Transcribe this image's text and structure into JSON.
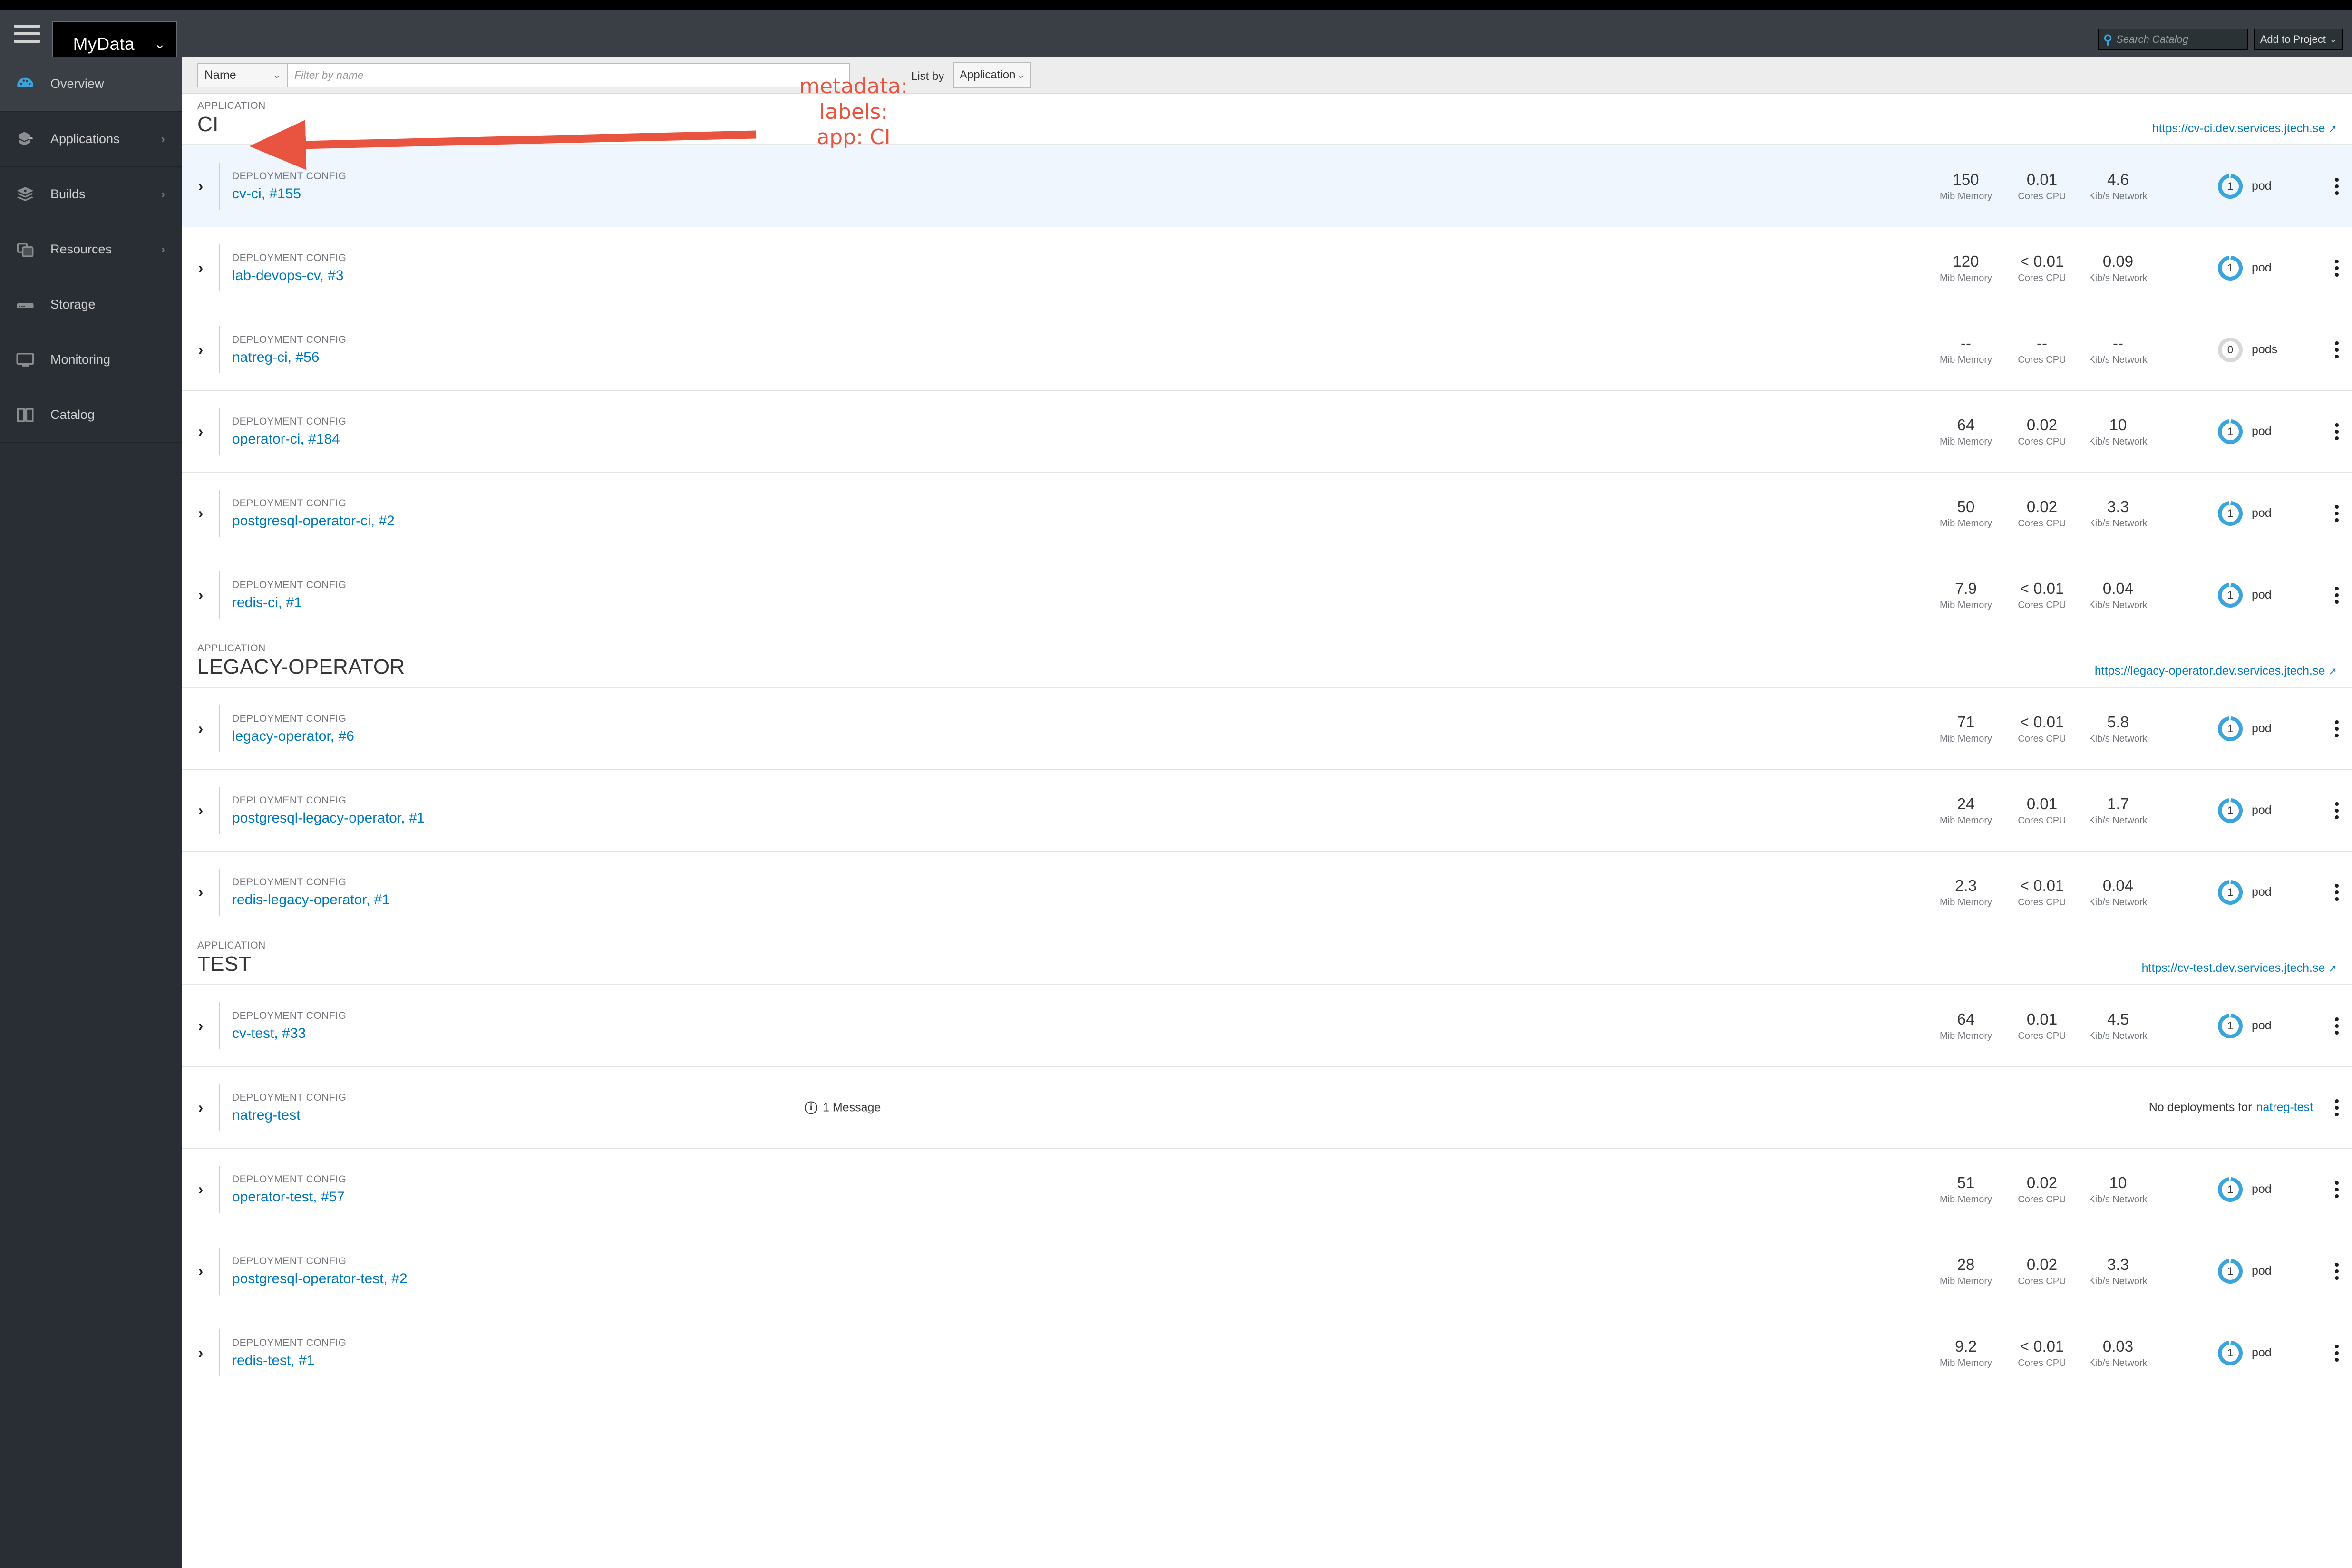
{
  "masthead": {
    "hamburger_icon": "hamburger-menu-icon",
    "project_name": "MyData",
    "project_caret": "⌄",
    "search": {
      "icon": "search-icon",
      "placeholder": "Search Catalog",
      "value": ""
    },
    "add_to_project": {
      "label": "Add to Project",
      "caret": "⌄"
    }
  },
  "sidebar": {
    "items": [
      {
        "label": "Overview",
        "icon": "dashboard-icon",
        "active": true,
        "expandable": false
      },
      {
        "label": "Applications",
        "icon": "applications-icon",
        "active": false,
        "expandable": true
      },
      {
        "label": "Builds",
        "icon": "builds-icon",
        "active": false,
        "expandable": true
      },
      {
        "label": "Resources",
        "icon": "resources-icon",
        "active": false,
        "expandable": true
      },
      {
        "label": "Storage",
        "icon": "storage-icon",
        "active": false,
        "expandable": false
      },
      {
        "label": "Monitoring",
        "icon": "monitoring-icon",
        "active": false,
        "expandable": false
      },
      {
        "label": "Catalog",
        "icon": "catalog-icon",
        "active": false,
        "expandable": false
      }
    ],
    "caret_glyph": "›"
  },
  "toolbar": {
    "filter_type": "Name",
    "filter_caret": "⌄",
    "filter_placeholder": "Filter by name",
    "filter_value": "",
    "list_by_label": "List by",
    "list_by_value": "Application",
    "list_by_caret": "⌄"
  },
  "annotation": {
    "line1": "metadata:",
    "line2": "labels:",
    "line3": "app: CI",
    "color": "#e8543f",
    "arrow": "arrow pointing from annotation to CI application title"
  },
  "labels": {
    "application_kicker": "APPLICATION",
    "deployment_kicker": "DEPLOYMENT CONFIG",
    "memory_label": "Mib Memory",
    "cpu_label": "Cores CPU",
    "network_label": "Kib/s Network",
    "pod_singular": "pod",
    "pod_plural": "pods",
    "external_link_icon": "external-link-icon",
    "expand_icon": "chevron-right-icon",
    "kebab_icon": "kebab-menu-icon",
    "info_icon": "info-circle-icon"
  },
  "colors": {
    "link": "#0079bc",
    "accent_donut": "#39a5dc",
    "highlight_row": "#eff6fd",
    "masthead": "#393f44",
    "sidebar": "#292e34",
    "annotation_red": "#e8543f"
  },
  "applications": [
    {
      "kicker": "APPLICATION",
      "name": "CI",
      "url": "https://cv-ci.dev.services.jtech.se",
      "rows": [
        {
          "kicker": "DEPLOYMENT CONFIG",
          "name": "cv-ci",
          "build": ", #155",
          "memory": "150",
          "cpu": "0.01",
          "network": "4.6",
          "pods": "1",
          "pods_label": "pod",
          "highlight": true
        },
        {
          "kicker": "DEPLOYMENT CONFIG",
          "name": "lab-devops-cv",
          "build": ", #3",
          "memory": "120",
          "cpu": "< 0.01",
          "network": "0.09",
          "pods": "1",
          "pods_label": "pod",
          "highlight": false
        },
        {
          "kicker": "DEPLOYMENT CONFIG",
          "name": "natreg-ci",
          "build": ", #56",
          "memory": "--",
          "cpu": "--",
          "network": "--",
          "pods": "0",
          "pods_label": "pods",
          "highlight": false
        },
        {
          "kicker": "DEPLOYMENT CONFIG",
          "name": "operator-ci",
          "build": ", #184",
          "memory": "64",
          "cpu": "0.02",
          "network": "10",
          "pods": "1",
          "pods_label": "pod",
          "highlight": false
        },
        {
          "kicker": "DEPLOYMENT CONFIG",
          "name": "postgresql-operator-ci",
          "build": ", #2",
          "memory": "50",
          "cpu": "0.02",
          "network": "3.3",
          "pods": "1",
          "pods_label": "pod",
          "highlight": false
        },
        {
          "kicker": "DEPLOYMENT CONFIG",
          "name": "redis-ci",
          "build": ", #1",
          "memory": "7.9",
          "cpu": "< 0.01",
          "network": "0.04",
          "pods": "1",
          "pods_label": "pod",
          "highlight": false
        }
      ]
    },
    {
      "kicker": "APPLICATION",
      "name": "LEGACY-OPERATOR",
      "url": "https://legacy-operator.dev.services.jtech.se",
      "rows": [
        {
          "kicker": "DEPLOYMENT CONFIG",
          "name": "legacy-operator",
          "build": ", #6",
          "memory": "71",
          "cpu": "< 0.01",
          "network": "5.8",
          "pods": "1",
          "pods_label": "pod",
          "highlight": false
        },
        {
          "kicker": "DEPLOYMENT CONFIG",
          "name": "postgresql-legacy-operator",
          "build": ", #1",
          "memory": "24",
          "cpu": "0.01",
          "network": "1.7",
          "pods": "1",
          "pods_label": "pod",
          "highlight": false
        },
        {
          "kicker": "DEPLOYMENT CONFIG",
          "name": "redis-legacy-operator",
          "build": ", #1",
          "memory": "2.3",
          "cpu": "< 0.01",
          "network": "0.04",
          "pods": "1",
          "pods_label": "pod",
          "highlight": false
        }
      ]
    },
    {
      "kicker": "APPLICATION",
      "name": "TEST",
      "url": "https://cv-test.dev.services.jtech.se",
      "rows": [
        {
          "kicker": "DEPLOYMENT CONFIG",
          "name": "cv-test",
          "build": ", #33",
          "memory": "64",
          "cpu": "0.01",
          "network": "4.5",
          "pods": "1",
          "pods_label": "pod",
          "highlight": false
        },
        {
          "kicker": "DEPLOYMENT CONFIG",
          "name": "natreg-test",
          "build": "",
          "message": "1 Message",
          "no_deploy_prefix": "No deployments for",
          "no_deploy_link": "natreg-test",
          "highlight": false
        },
        {
          "kicker": "DEPLOYMENT CONFIG",
          "name": "operator-test",
          "build": ", #57",
          "memory": "51",
          "cpu": "0.02",
          "network": "10",
          "pods": "1",
          "pods_label": "pod",
          "highlight": false
        },
        {
          "kicker": "DEPLOYMENT CONFIG",
          "name": "postgresql-operator-test",
          "build": ", #2",
          "memory": "28",
          "cpu": "0.02",
          "network": "3.3",
          "pods": "1",
          "pods_label": "pod",
          "highlight": false
        },
        {
          "kicker": "DEPLOYMENT CONFIG",
          "name": "redis-test",
          "build": ", #1",
          "memory": "9.2",
          "cpu": "< 0.01",
          "network": "0.03",
          "pods": "1",
          "pods_label": "pod",
          "highlight": false
        }
      ]
    }
  ]
}
